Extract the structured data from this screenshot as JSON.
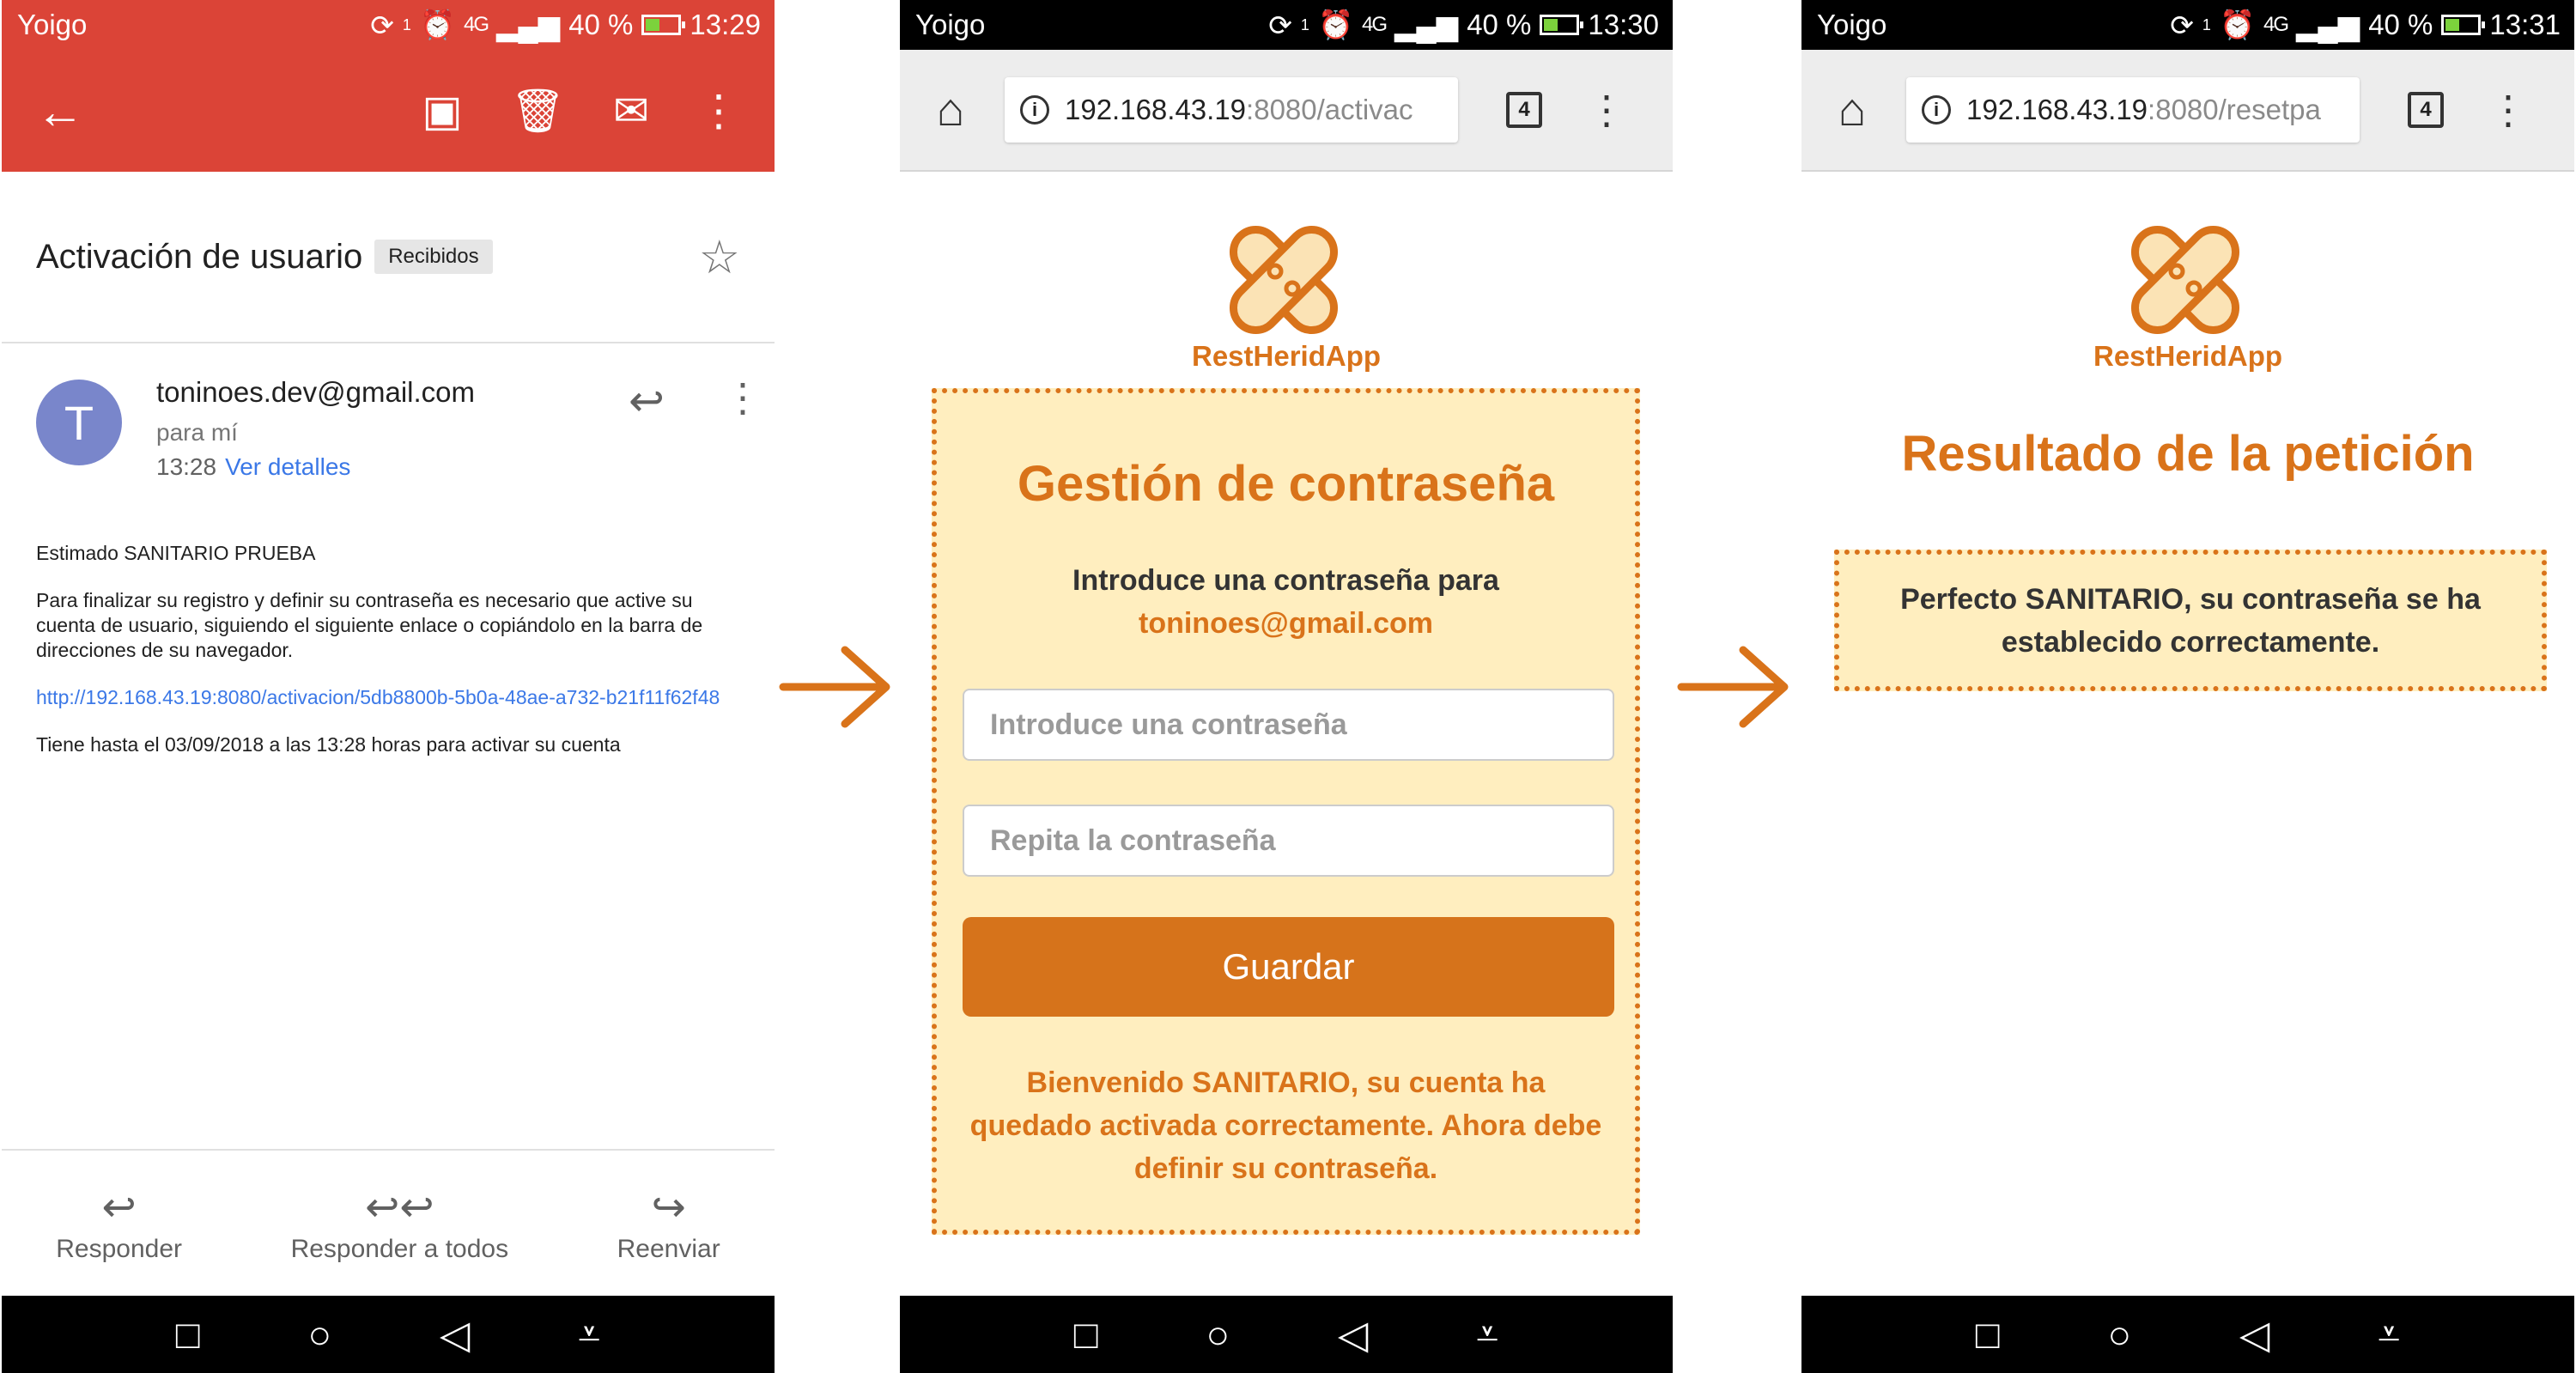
{
  "colors": {
    "gmail_red": "#db4437",
    "accent_orange": "#d9731a",
    "card_bg": "#ffeebf",
    "link_blue": "#3b78e7"
  },
  "screens": [
    {
      "status": {
        "carrier": "Yoigo",
        "sync_count": "1",
        "network": "4G",
        "battery": "40 %",
        "time": "13:29"
      },
      "email": {
        "subject": "Activación de usuario",
        "label": "Recibidos",
        "avatar_letter": "T",
        "from": "toninoes.dev@gmail.com",
        "to": "para mí",
        "time": "13:28",
        "details_link": "Ver detalles",
        "greeting": "Estimado SANITARIO PRUEBA",
        "paragraph": "Para finalizar su registro y definir su contraseña es necesario que active su cuenta de usuario, siguiendo el siguiente enlace o copiándolo en la barra de direcciones de su navegador.",
        "link": "http://192.168.43.19:8080/activacion/5db8800b-5b0a-48ae-a732-b21f11f62f48",
        "deadline": "Tiene hasta el 03/09/2018 a las 13:28 horas para activar su cuenta",
        "actions": [
          "Responder",
          "Responder a todos",
          "Reenviar"
        ]
      }
    },
    {
      "status": {
        "carrier": "Yoigo",
        "sync_count": "1",
        "network": "4G",
        "battery": "40 %",
        "time": "13:30"
      },
      "browser": {
        "url_host": "192.168.43.19",
        "url_rest": ":8080/activac",
        "tab_count": "4"
      },
      "app": {
        "brand": "RestHeridApp",
        "title": "Gestión de contraseña",
        "intro": "Introduce una contraseña para",
        "email": "toninoes@gmail.com",
        "password_placeholder": "Introduce una contraseña",
        "repeat_placeholder": "Repita la contraseña",
        "save_button": "Guardar",
        "welcome": "Bienvenido SANITARIO, su cuenta ha quedado activada correctamente. Ahora debe definir su contraseña."
      }
    },
    {
      "status": {
        "carrier": "Yoigo",
        "sync_count": "1",
        "network": "4G",
        "battery": "40 %",
        "time": "13:31"
      },
      "browser": {
        "url_host": "192.168.43.19",
        "url_rest": ":8080/resetpa",
        "tab_count": "4"
      },
      "app": {
        "brand": "RestHeridApp",
        "title": "Resultado de la petición",
        "message": "Perfecto SANITARIO, su contraseña se ha establecido correctamente."
      }
    }
  ]
}
